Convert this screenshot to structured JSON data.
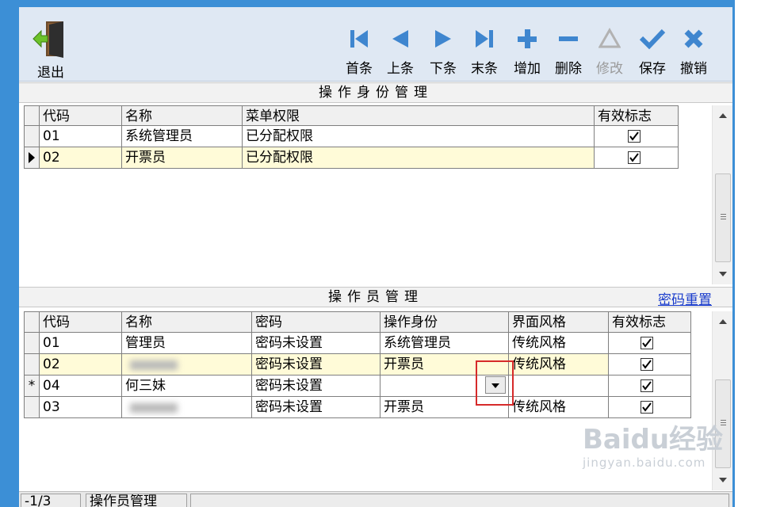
{
  "toolbar": {
    "exit_label": "退出",
    "buttons": [
      {
        "label": "首条",
        "icon": "first-record-icon",
        "enabled": true
      },
      {
        "label": "上条",
        "icon": "previous-record-icon",
        "enabled": true
      },
      {
        "label": "下条",
        "icon": "next-record-icon",
        "enabled": true
      },
      {
        "label": "末条",
        "icon": "last-record-icon",
        "enabled": true
      },
      {
        "label": "增加",
        "icon": "add-icon",
        "enabled": true
      },
      {
        "label": "删除",
        "icon": "delete-icon",
        "enabled": true
      },
      {
        "label": "修改",
        "icon": "edit-icon",
        "enabled": false
      },
      {
        "label": "保存",
        "icon": "save-check-icon",
        "enabled": true
      },
      {
        "label": "撤销",
        "icon": "cancel-x-icon",
        "enabled": true
      }
    ]
  },
  "roles_section": {
    "title": "操作身份管理",
    "columns": [
      "代码",
      "名称",
      "菜单权限",
      "有效标志"
    ],
    "rows": [
      {
        "code": "01",
        "name": "系统管理员",
        "menu": "已分配权限",
        "valid": true
      },
      {
        "code": "02",
        "name": "开票员",
        "menu": "已分配权限",
        "valid": true
      }
    ]
  },
  "operators_section": {
    "title": "操作员管理",
    "reset_password_link": "密码重置",
    "columns": [
      "代码",
      "名称",
      "密码",
      "操作身份",
      "界面风格",
      "有效标志"
    ],
    "rows": [
      {
        "code": "01",
        "name": "管理员",
        "password": "密码未设置",
        "role": "系统管理员",
        "style": "传统风格",
        "valid": true,
        "indicator": ""
      },
      {
        "code": "02",
        "name": "",
        "password": "密码未设置",
        "role": "开票员",
        "style": "传统风格",
        "valid": true,
        "indicator": ""
      },
      {
        "code": "04",
        "name": "何三妹",
        "password": "密码未设置",
        "role": "",
        "style": "",
        "valid": true,
        "indicator": "*"
      },
      {
        "code": "03",
        "name": "",
        "password": "密码未设置",
        "role": "开票员",
        "style": "传统风格",
        "valid": true,
        "indicator": ""
      }
    ]
  },
  "status_bar": {
    "record_position": "-1/3",
    "module_name": "操作员管理"
  },
  "watermark": {
    "brand": "Baidu经验",
    "url": "jingyan.baidu.com"
  },
  "colors": {
    "frame_blue": "#3c8fd6",
    "toolbar_icon_blue": "#3f86cf",
    "selected_row": "#fffbd8",
    "highlight_box": "#d62a2a",
    "link_blue": "#1a3ccc"
  }
}
